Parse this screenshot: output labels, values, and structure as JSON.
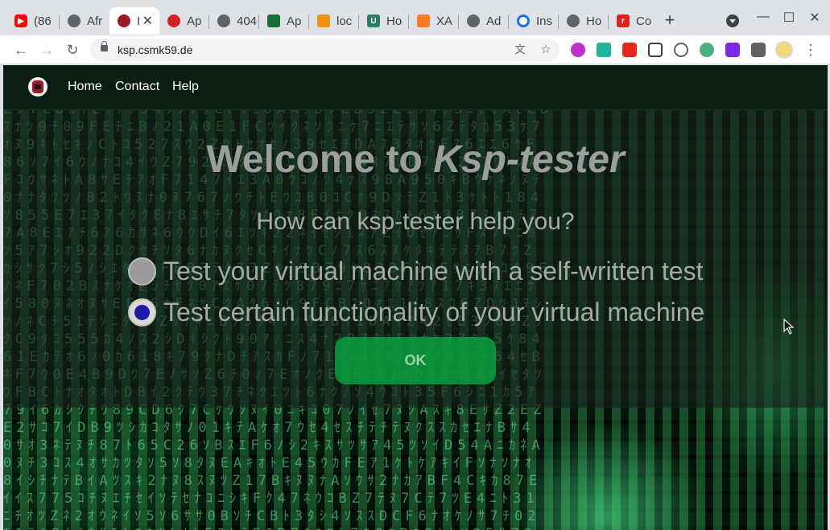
{
  "browser": {
    "tabs": [
      {
        "label": "(86",
        "icon": "youtube-icon",
        "color": "#ff0000"
      },
      {
        "label": "Afr",
        "icon": "globe-icon",
        "color": "#5f6368"
      },
      {
        "label": "I",
        "icon": "ksp-logo-icon",
        "color": "#9b1b24",
        "active": true
      },
      {
        "label": "Ap",
        "icon": "apache-feather-icon",
        "color": "#d22128"
      },
      {
        "label": "404",
        "icon": "globe-icon",
        "color": "#5f6368"
      },
      {
        "label": "Ap",
        "icon": "app-icon",
        "color": "#1a6e3a"
      },
      {
        "label": "loc",
        "icon": "phpmyadmin-icon",
        "color": "#f29111"
      },
      {
        "label": "Ho",
        "icon": "ut-icon",
        "color": "#2e7d6b"
      },
      {
        "label": "XA",
        "icon": "xampp-icon",
        "color": "#fb7a24"
      },
      {
        "label": "Ad",
        "icon": "globe-icon",
        "color": "#5f6368"
      },
      {
        "label": "Ins",
        "icon": "spinner-icon",
        "color": "#1a73e8"
      },
      {
        "label": "Ho",
        "icon": "globe-icon",
        "color": "#5f6368"
      },
      {
        "label": "Co",
        "icon": "r-logo-icon",
        "color": "#e0201b"
      }
    ],
    "url": "ksp.csmk59.de"
  },
  "navbar": {
    "links": [
      "Home",
      "Contact",
      "Help"
    ]
  },
  "main": {
    "title_prefix": "Welcome to ",
    "title_emph": "Ksp-tester",
    "question": "How can ksp-tester help you?",
    "options": [
      {
        "label": "Test your virtual machine with a self-written test",
        "checked": false
      },
      {
        "label": "Test certain functionality of your virtual machine",
        "checked": true
      }
    ],
    "ok_label": "OK"
  },
  "colors": {
    "accent_green": "#08aa41",
    "radio_selected": "#1c1ca8",
    "navbar_bg": "#0b1e13"
  }
}
